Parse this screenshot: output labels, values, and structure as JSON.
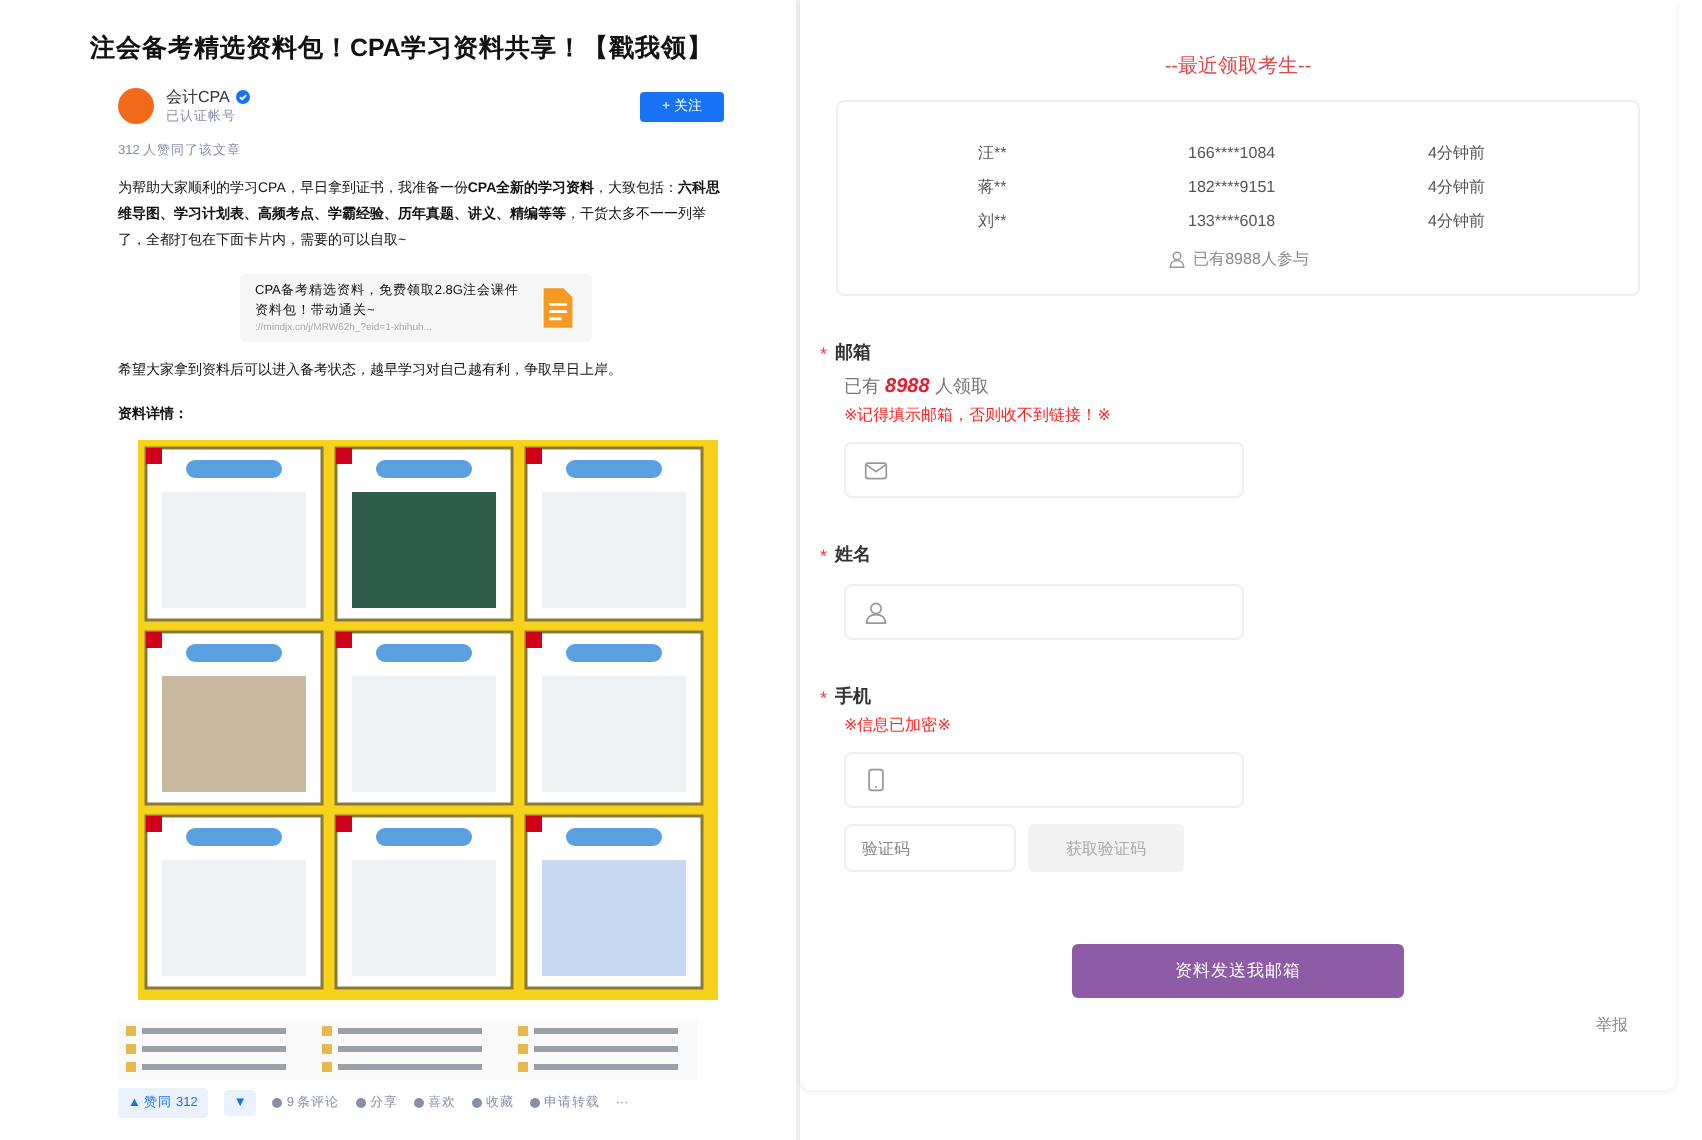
{
  "article": {
    "title": "注会备考精选资料包！CPA学习资料共享！【戳我领】",
    "author": {
      "name": "会计CPA",
      "verified": true,
      "subtitle": "已认证帐号"
    },
    "follow_button": "+ 关注",
    "upvote_note": "312 人赞同了该文章",
    "intro": "为帮助大家顺利的学习CPA，早日拿到证书，我准备一份**CPA全新的学习资料**，大致包括：**六科思维导图、学习计划表、高频考点、学霸经验、历年真题、讲义、精编等等**，干货太多不一一列举了，全都打包在下面卡片内，需要的可以自取~",
    "link_card": {
      "title": "CPA备考精选资料，免费领取2.8G注会课件资料包！带动通关~",
      "url": "://mindjx.cn/j/MRW62h_?eid=1-xhihuh..."
    },
    "outro": "希望大家拿到资料后可以进入备考状态，越早学习对自己越有利，争取早日上岸。",
    "details_label": "资料详情：",
    "actions": [
      {
        "kind": "vote",
        "label": "▲ 赞同 312"
      },
      {
        "kind": "down",
        "label": "▼"
      },
      {
        "kind": "comment",
        "label": "9 条评论"
      },
      {
        "kind": "share",
        "label": "分享"
      },
      {
        "kind": "like",
        "label": "喜欢"
      },
      {
        "kind": "star",
        "label": "收藏"
      },
      {
        "kind": "repost",
        "label": "申请转载"
      },
      {
        "kind": "more",
        "label": "···"
      }
    ]
  },
  "claim_panel": {
    "title": "--最近领取考生--",
    "recent": [
      {
        "name": "汪**",
        "phone": "166****1084",
        "time": "4分钟前"
      },
      {
        "name": "蒋**",
        "phone": "182****9151",
        "time": "4分钟前"
      },
      {
        "name": "刘**",
        "phone": "133****6018",
        "time": "4分钟前"
      }
    ],
    "participants": "已有8988人参与",
    "fields": [
      {
        "kind": "email",
        "label": "邮箱",
        "required_mark": "*",
        "count_prefix": "已有",
        "count": "8988",
        "count_suffix": "人领取",
        "note": "※记得填示邮箱，否则收不到链接！※"
      },
      {
        "kind": "name",
        "label": "姓名",
        "required_mark": "*"
      },
      {
        "kind": "phone",
        "label": "手机",
        "required_mark": "*",
        "note": "※信息已加密※",
        "code_placeholder": "验证码",
        "code_button": "获取验证码"
      }
    ],
    "submit": "资料发送我邮箱",
    "report": "举报"
  }
}
